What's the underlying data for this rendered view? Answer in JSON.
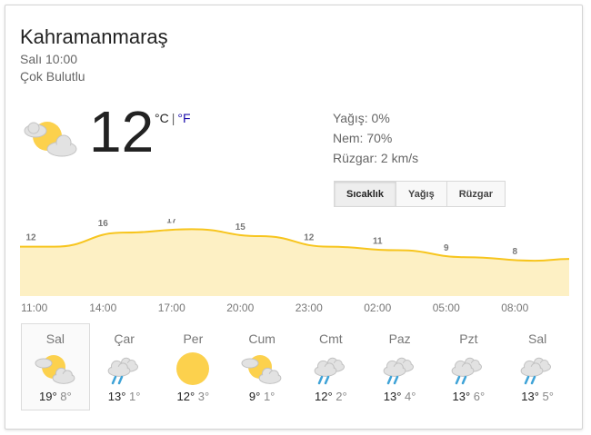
{
  "header": {
    "location": "Kahramanmaraş",
    "time": "Salı 10:00",
    "condition": "Çok Bulutlu"
  },
  "current": {
    "temperature": "12",
    "unit_c": "°C",
    "separator": "|",
    "unit_f": "°F",
    "icon": "partly-cloudy-icon"
  },
  "details": {
    "precipitation": "Yağış: 0%",
    "humidity": "Nem: 70%",
    "wind": "Rüzgar: 2 km/s"
  },
  "tabs": [
    {
      "label": "Sıcaklık",
      "active": true
    },
    {
      "label": "Yağış",
      "active": false
    },
    {
      "label": "Rüzgar",
      "active": false
    }
  ],
  "chart_data": {
    "type": "area",
    "x": [
      "11:00",
      "14:00",
      "17:00",
      "20:00",
      "23:00",
      "02:00",
      "05:00",
      "08:00"
    ],
    "values": [
      12,
      16,
      17,
      15,
      12,
      11,
      9,
      8
    ],
    "color_line": "#f7c51e",
    "color_fill": "#fdf0c4"
  },
  "forecast": [
    {
      "day": "Sal",
      "icon": "partly-cloudy-icon",
      "hi": "19°",
      "lo": "8°",
      "selected": true
    },
    {
      "day": "Çar",
      "icon": "cloud-rain-icon",
      "hi": "13°",
      "lo": "1°",
      "selected": false
    },
    {
      "day": "Per",
      "icon": "sun-icon",
      "hi": "12°",
      "lo": "3°",
      "selected": false
    },
    {
      "day": "Cum",
      "icon": "partly-cloudy-icon",
      "hi": "9°",
      "lo": "1°",
      "selected": false
    },
    {
      "day": "Cmt",
      "icon": "cloud-rain-icon",
      "hi": "12°",
      "lo": "2°",
      "selected": false
    },
    {
      "day": "Paz",
      "icon": "cloud-rain-icon",
      "hi": "13°",
      "lo": "4°",
      "selected": false
    },
    {
      "day": "Pzt",
      "icon": "cloud-rain-icon",
      "hi": "13°",
      "lo": "6°",
      "selected": false
    },
    {
      "day": "Sal",
      "icon": "cloud-rain-icon",
      "hi": "13°",
      "lo": "5°",
      "selected": false
    }
  ]
}
